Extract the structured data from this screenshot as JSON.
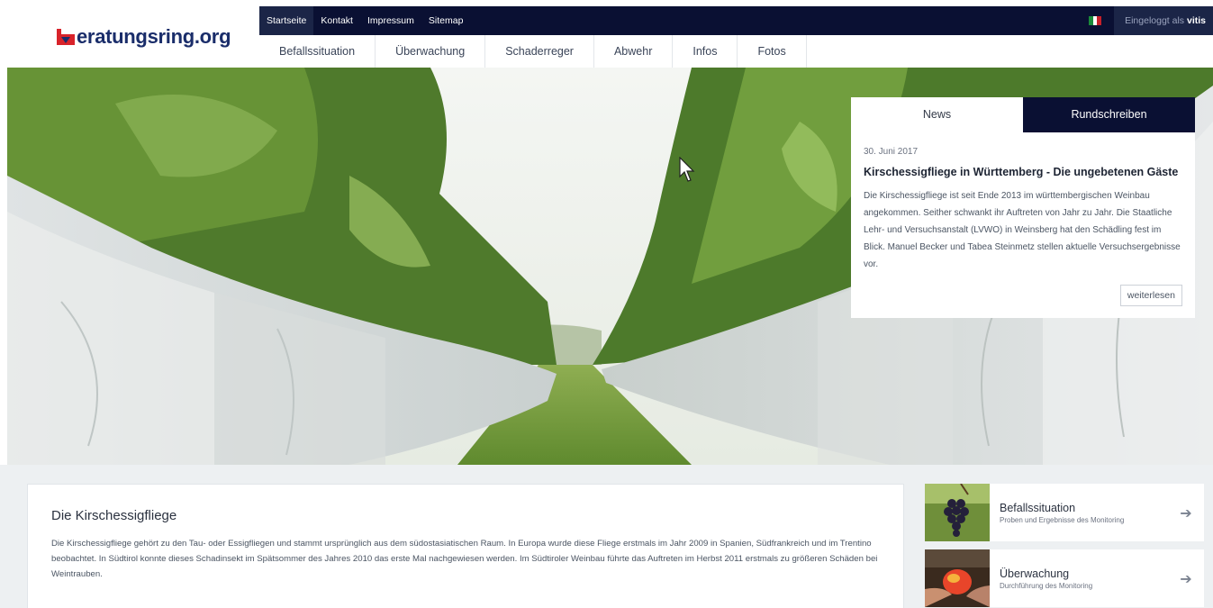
{
  "brand": {
    "logo_text": "eratungsring.org"
  },
  "topbar": {
    "links": [
      "Startseite",
      "Kontakt",
      "Impressum",
      "Sitemap"
    ],
    "login_prefix": "Eingeloggt als",
    "login_user": "vitis",
    "flag_colors": [
      "#1a8a3a",
      "#ffffff",
      "#c8202a"
    ]
  },
  "mainnav": [
    "Befallssituation",
    "Überwachung",
    "Schaderreger",
    "Abwehr",
    "Infos",
    "Fotos"
  ],
  "news": {
    "tabs": [
      "News",
      "Rundschreiben"
    ],
    "date": "30. Juni 2017",
    "title": "Kirschessigfliege in Württemberg - Die ungebetenen Gäste",
    "text": "Die Kirschessigfliege ist seit Ende 2013 im württembergischen Weinbau angekommen. Seither schwankt ihr Auftreten von Jahr zu Jahr. Die Staatliche Lehr- und Versuchsanstalt (LVWO) in Weinsberg hat den Schädling fest im Blick. Manuel Becker und Tabea Steinmetz stellen aktuelle Versuchsergebnisse vor.",
    "more": "weiterlesen"
  },
  "article": {
    "title": "Die Kirschessigfliege",
    "text": "Die Kirschessigfliege gehört zu den Tau- oder Essigfliegen und stammt ursprünglich aus dem südostasiatischen Raum. In Europa wurde diese Fliege erstmals im Jahr 2009 in Spanien, Südfrankreich und im Trentino beobachtet. In Südtirol konnte dieses Schadinsekt im Spätsommer des Jahres 2010 das erste Mal nachgewiesen werden. Im Südtiroler Weinbau führte das Auftreten im Herbst 2011 erstmals zu größeren Schäden bei Weintrauben."
  },
  "side_cards": [
    {
      "title": "Befallssituation",
      "subtitle": "Proben und Ergebnisse des Monitoring"
    },
    {
      "title": "Überwachung",
      "subtitle": "Durchführung des Monitoring"
    }
  ],
  "colors": {
    "navy": "#0a1033",
    "brand_red": "#d8232a",
    "brand_blue": "#1a2d6a"
  }
}
